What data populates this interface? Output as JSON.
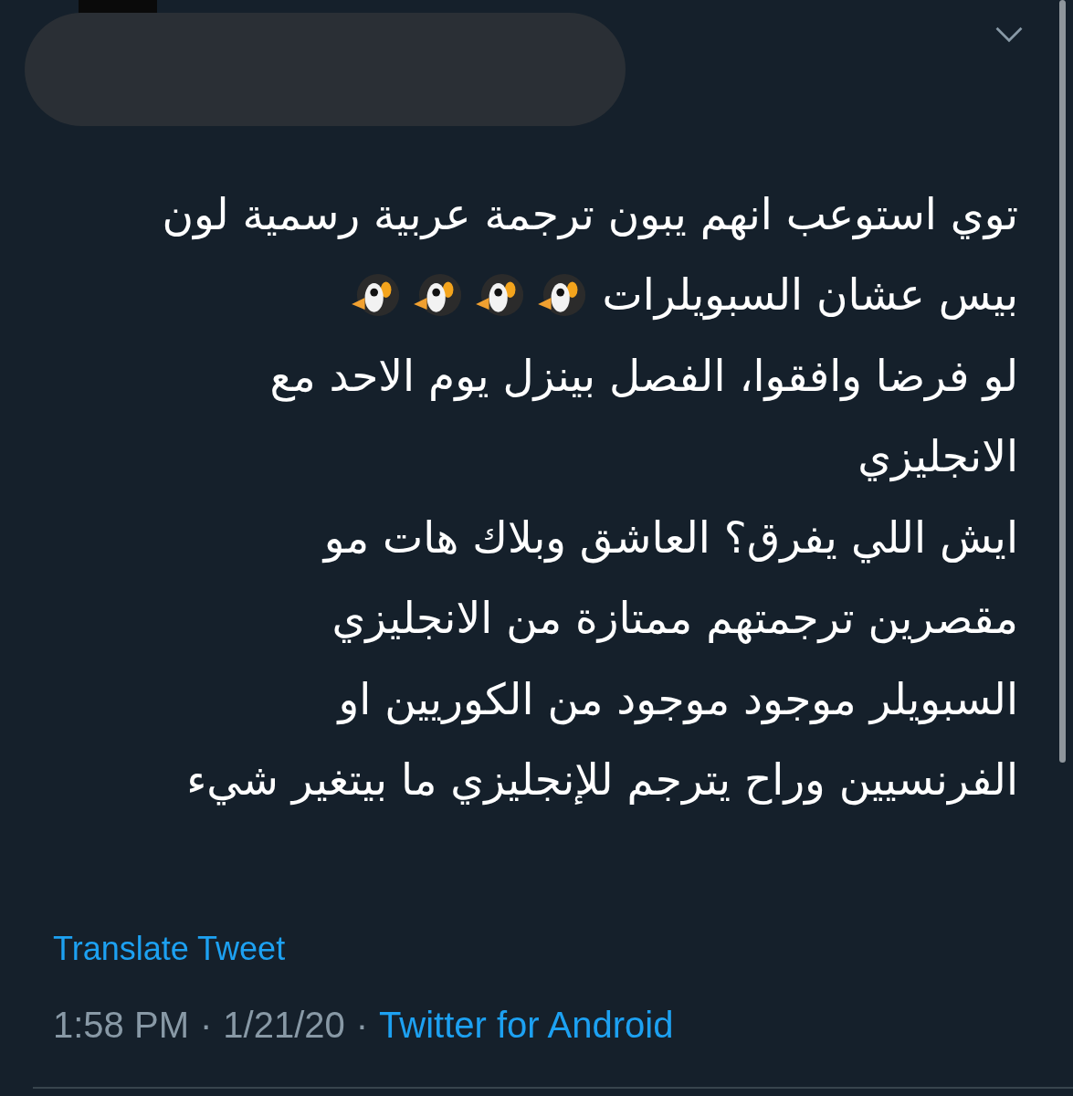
{
  "tweet": {
    "lines": [
      {
        "text": "توي استوعب انهم يبون ترجمة عربية رسمية لون"
      },
      {
        "text": "بيس عشان السبويلرات",
        "icons": [
          {
            "kind": "penguin"
          },
          {
            "kind": "penguin"
          },
          {
            "kind": "penguin"
          },
          {
            "kind": "penguin"
          }
        ]
      },
      {
        "text": "لو فرضا وافقوا، الفصل بينزل يوم الاحد مع"
      },
      {
        "text": "الانجليزي"
      },
      {
        "text": "ايش اللي يفرق؟ العاشق وبلاك هات مو"
      },
      {
        "text": "مقصرين ترجمتهم ممتازة من الانجليزي"
      },
      {
        "text": "السبويلر موجود موجود من الكوريين او"
      },
      {
        "text": "الفرنسيين وراح يترجم للإنجليزي ما بيتغير شيء"
      }
    ],
    "translate_link": "Translate Tweet",
    "time": "1:58 PM",
    "separator_1": "·",
    "date": "1/21/20",
    "separator_2": "·",
    "source": "Twitter for Android"
  }
}
